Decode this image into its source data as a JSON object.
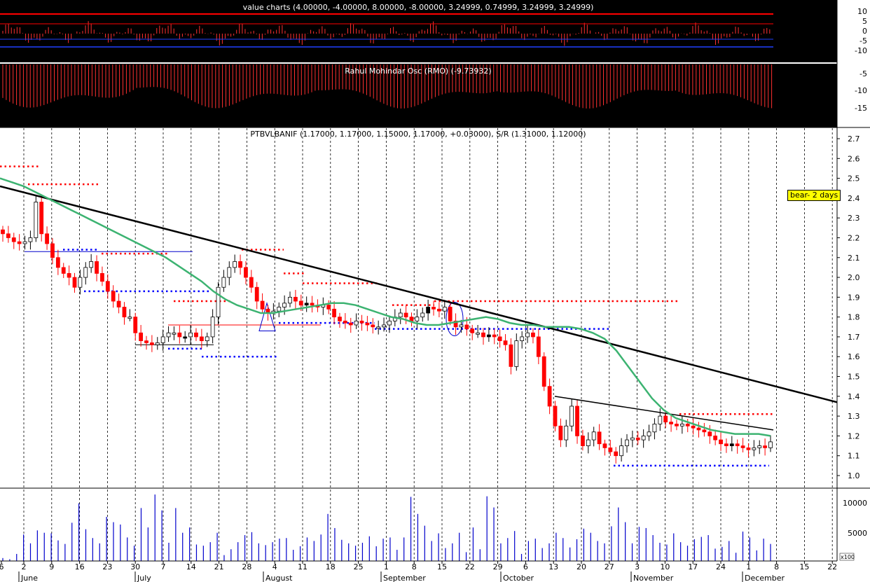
{
  "panels": {
    "value_charts": {
      "title": "value charts (4.00000, -4.00000, 8.00000, -8.00000, 3.24999, 0.74999, 3.24999, 3.24999)",
      "yticks": [
        "10",
        "5",
        "0",
        "-5",
        "-10"
      ],
      "colors": {
        "background": "#000000",
        "bars": "#ff2020",
        "upper_line": "#ff0000",
        "lower_line": "#0000ff"
      }
    },
    "rmo": {
      "title": "Rahul Mohindar Osc (RMO) (-9.73932)",
      "yticks": [
        "-5",
        "-10",
        "-15"
      ],
      "colors": {
        "background": "#000000",
        "bars": "#ff2020"
      }
    },
    "price": {
      "title": "PTBVLBANIF (1.17000, 1.17000, 1.15000, 1.17000, +0.03000), S/R (1.31000, 1.12000)",
      "yticks": [
        "2.7",
        "2.6",
        "2.5",
        "2.4",
        "2.3",
        "2.2",
        "2.1",
        "2.0",
        "1.9",
        "1.8",
        "1.7",
        "1.6",
        "1.5",
        "1.4",
        "1.3",
        "1.2",
        "1.1",
        "1.0"
      ],
      "signal_label": "bear- 2 days",
      "colors": {
        "up_candle": "#ffffff",
        "down_candle": "#ff0000",
        "dark_candle": "#000000",
        "ma": "#3cb371",
        "trend": "#000000",
        "support": "#0000ff",
        "resistance": "#ff0000"
      }
    },
    "volume": {
      "yticks": [
        "10000",
        "5000"
      ],
      "multiplier_label": "x100",
      "colors": {
        "bars": "#0000cc"
      }
    }
  },
  "x_axis": {
    "day_labels": [
      "6",
      "2",
      "9",
      "16",
      "23",
      "30",
      "7",
      "14",
      "21",
      "28",
      "4",
      "11",
      "18",
      "25",
      "1",
      "8",
      "15",
      "22",
      "29",
      "6",
      "13",
      "20",
      "27",
      "3",
      "10",
      "17",
      "24",
      "1",
      "8",
      "15",
      "22"
    ],
    "month_labels": [
      "June",
      "July",
      "August",
      "September",
      "October",
      "November",
      "December"
    ]
  },
  "chart_data": {
    "type": "candlestick",
    "title": "PTBVLBANIF (1.17000, 1.17000, 1.15000, 1.17000, +0.03000), S/R (1.31000, 1.12000)",
    "ylim": [
      0.95,
      2.75
    ],
    "grid": true,
    "support": 1.12,
    "resistance": 1.31,
    "last_bar": {
      "open": 1.17,
      "high": 1.17,
      "low": 1.15,
      "close": 1.17,
      "change": 0.03
    },
    "close_series": [
      2.22,
      2.2,
      2.18,
      2.17,
      2.18,
      2.2,
      2.38,
      2.22,
      2.17,
      2.1,
      2.05,
      2.02,
      2.0,
      1.95,
      2.0,
      2.05,
      2.08,
      2.02,
      1.98,
      1.93,
      1.88,
      1.85,
      1.8,
      1.8,
      1.72,
      1.68,
      1.67,
      1.66,
      1.67,
      1.7,
      1.72,
      1.72,
      1.7,
      1.7,
      1.72,
      1.7,
      1.68,
      1.7,
      1.8,
      1.95,
      2.0,
      2.05,
      2.08,
      2.05,
      2.0,
      1.95,
      1.88,
      1.84,
      1.82,
      1.83,
      1.85,
      1.87,
      1.9,
      1.88,
      1.86,
      1.87,
      1.86,
      1.85,
      1.86,
      1.84,
      1.8,
      1.78,
      1.77,
      1.76,
      1.78,
      1.77,
      1.76,
      1.75,
      1.75,
      1.76,
      1.78,
      1.8,
      1.82,
      1.8,
      1.78,
      1.8,
      1.82,
      1.85,
      1.84,
      1.83,
      1.85,
      1.78,
      1.75,
      1.76,
      1.74,
      1.72,
      1.72,
      1.7,
      1.71,
      1.7,
      1.68,
      1.66,
      1.55,
      1.68,
      1.7,
      1.72,
      1.7,
      1.6,
      1.45,
      1.35,
      1.25,
      1.18,
      1.25,
      1.35,
      1.2,
      1.15,
      1.18,
      1.22,
      1.16,
      1.14,
      1.12,
      1.1,
      1.15,
      1.18,
      1.19,
      1.18,
      1.2,
      1.22,
      1.26,
      1.3,
      1.27,
      1.26,
      1.25,
      1.26,
      1.25,
      1.24,
      1.23,
      1.22,
      1.2,
      1.18,
      1.16,
      1.15,
      1.16,
      1.15,
      1.14,
      1.13,
      1.14,
      1.15,
      1.14,
      1.17
    ],
    "ma_series": [
      2.5,
      2.48,
      2.46,
      2.43,
      2.4,
      2.37,
      2.34,
      2.31,
      2.28,
      2.25,
      2.22,
      2.19,
      2.16,
      2.13,
      2.1,
      2.06,
      2.02,
      1.98,
      1.93,
      1.89,
      1.86,
      1.84,
      1.82,
      1.82,
      1.83,
      1.84,
      1.85,
      1.86,
      1.87,
      1.87,
      1.86,
      1.84,
      1.82,
      1.8,
      1.79,
      1.77,
      1.76,
      1.76,
      1.77,
      1.78,
      1.79,
      1.8,
      1.79,
      1.77,
      1.76,
      1.76,
      1.75,
      1.75,
      1.75,
      1.74,
      1.72,
      1.69,
      1.63,
      1.55,
      1.47,
      1.39,
      1.33,
      1.29,
      1.27,
      1.25,
      1.23,
      1.22,
      1.21,
      1.21,
      1.21,
      1.2
    ],
    "trendline_main": {
      "from": 2.46,
      "to": 1.37
    },
    "trendline_recent": {
      "from": 1.4,
      "to": 1.23
    },
    "volume": [
      500,
      300,
      1200,
      4500,
      3000,
      5200,
      4800,
      4700,
      3500,
      2900,
      6500,
      9800,
      5400,
      3900,
      3000,
      7500,
      6600,
      6200,
      4000,
      2600,
      9000,
      5700,
      11300,
      8600,
      3100,
      9000,
      4800,
      5700,
      2800,
      2600,
      3200,
      4800,
      1000,
      2000,
      3200,
      4400,
      4900,
      3000,
      2700,
      3200,
      3800,
      3900,
      1900,
      2500,
      4000,
      3400,
      4500,
      8000,
      5600,
      3600,
      3000,
      2600,
      3100,
      4200,
      2500,
      3800,
      4000,
      1900,
      4000,
      10900,
      8000,
      6000,
      3400,
      4700,
      2200,
      3000,
      4800,
      1500,
      5700,
      2000,
      11000,
      9100,
      3000,
      3900,
      5100,
      1200,
      3400,
      3800,
      2200,
      3000,
      4800,
      3900,
      2300,
      3700,
      5500,
      4800,
      3400,
      3000,
      5900,
      9100,
      6600,
      3000,
      5800,
      5600,
      4400,
      3100,
      2800,
      4700,
      3200,
      2600,
      3700,
      4100,
      4400,
      2100,
      2400,
      3400,
      1400,
      5000,
      4000,
      1800,
      3800,
      2900
    ]
  }
}
